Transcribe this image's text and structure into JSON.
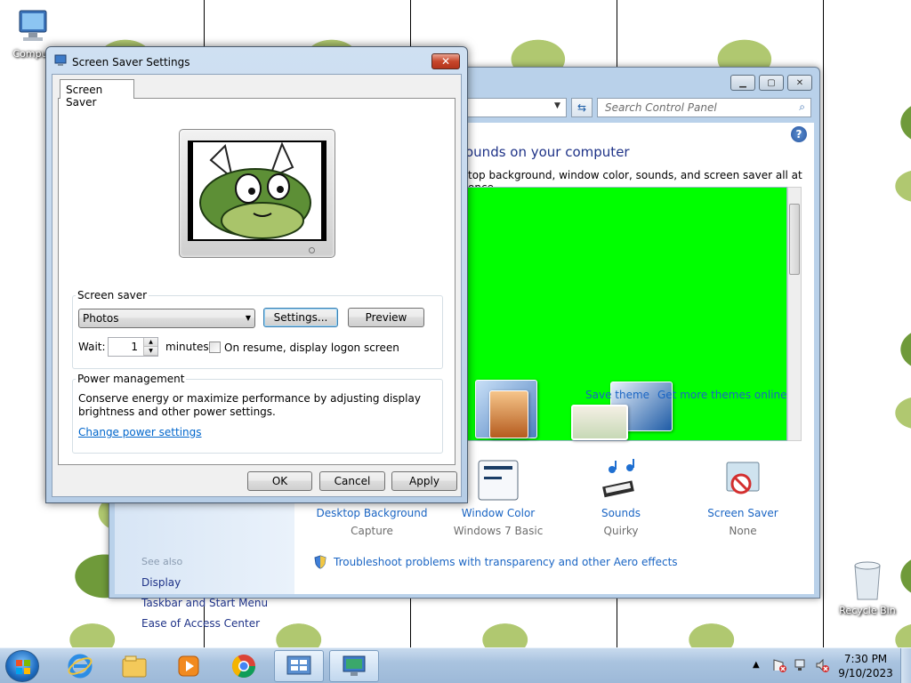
{
  "desktop": {
    "icons": [
      {
        "label": "Compu"
      },
      {
        "label": "Recycle Bin"
      }
    ]
  },
  "control_panel": {
    "search_placeholder": "Search Control Panel",
    "heading": "ounds on your computer",
    "subheading": "top background, window color, sounds, and screen saver all at once.",
    "theme_links": {
      "save": "Save theme",
      "more": "Get more themes online"
    },
    "theme_preview_color": "#00ff00",
    "bottom_items": [
      {
        "label": "Desktop Background",
        "sub": "Capture",
        "icon": "desktop-background-icon"
      },
      {
        "label": "Window Color",
        "sub": "Windows 7 Basic",
        "icon": "window-color-icon"
      },
      {
        "label": "Sounds",
        "sub": "Quirky",
        "icon": "sounds-icon"
      },
      {
        "label": "Screen Saver",
        "sub": "None",
        "icon": "screen-saver-icon"
      }
    ],
    "see_also": "See also",
    "left_links": [
      "Display",
      "Taskbar and Start Menu",
      "Ease of Access Center"
    ],
    "aero_link": "Troubleshoot problems with transparency and other Aero effects",
    "help": "?"
  },
  "dialog": {
    "title": "Screen Saver Settings",
    "close": "✕",
    "tab": "Screen Saver",
    "screen_saver_group": "Screen saver",
    "selected_screensaver": "Photos",
    "settings_button": "Settings...",
    "preview_button": "Preview",
    "wait_label": "Wait:",
    "wait_value": "1",
    "minutes_label": "minutes",
    "resume_checkbox_label": "On resume, display logon screen",
    "resume_checked": false,
    "power_group": "Power management",
    "power_text_1": "Conserve energy or maximize performance by adjusting display",
    "power_text_2": "brightness and other power settings.",
    "power_link": "Change power settings",
    "ok": "OK",
    "cancel": "Cancel",
    "apply": "Apply"
  },
  "taskbar": {
    "items": [
      "start-button",
      "internet-explorer-icon",
      "windows-explorer-icon",
      "media-player-icon",
      "chrome-icon",
      "control-panel-icon",
      "screen-saver-settings-icon"
    ],
    "time": "7:30 PM",
    "date": "9/10/2023"
  }
}
